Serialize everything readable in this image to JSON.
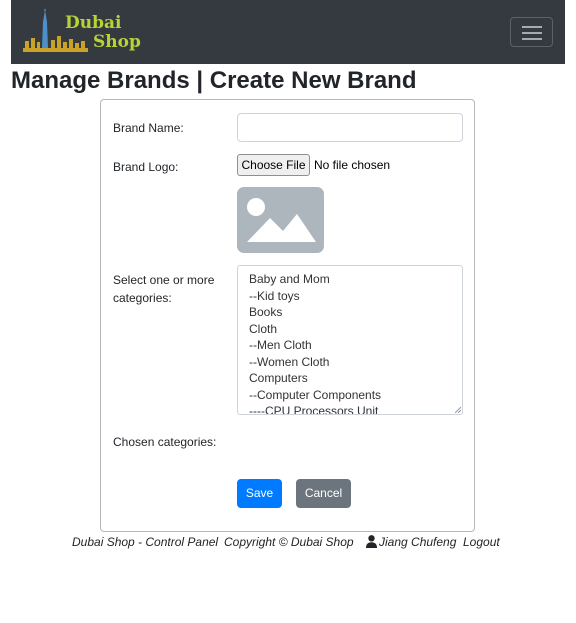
{
  "navbar": {
    "logo_line1": "Dubai",
    "logo_line2": "Shop",
    "toggler_icon": "hamburger-menu-icon"
  },
  "page": {
    "heading": "Manage Brands | Create New Brand"
  },
  "form": {
    "brand_name_label": "Brand Name:",
    "brand_name_value": "",
    "brand_logo_label": "Brand Logo:",
    "choose_file_label": "Choose File",
    "file_status": "No file chosen",
    "logo_placeholder_icon": "image-placeholder-icon",
    "categories_label": "Select one or more categories:",
    "categories": [
      "Baby and Mom",
      "--Kid toys",
      "Books",
      "Cloth",
      "--Men Cloth",
      "--Women Cloth",
      "Computers",
      "--Computer Components",
      "----CPU Processors Unit"
    ],
    "chosen_label": "Chosen categories:",
    "save_label": "Save",
    "cancel_label": "Cancel"
  },
  "footer": {
    "control_panel": "Dubai Shop - Control Panel",
    "copyright": "Copyright © Dubai Shop",
    "user_icon": "user-icon",
    "user_name": "Jiang Chufeng",
    "logout": "Logout"
  },
  "colors": {
    "navbar_bg": "#343a40",
    "logo_text": "#b8d432",
    "primary": "#007bff",
    "secondary": "#6c757d"
  }
}
